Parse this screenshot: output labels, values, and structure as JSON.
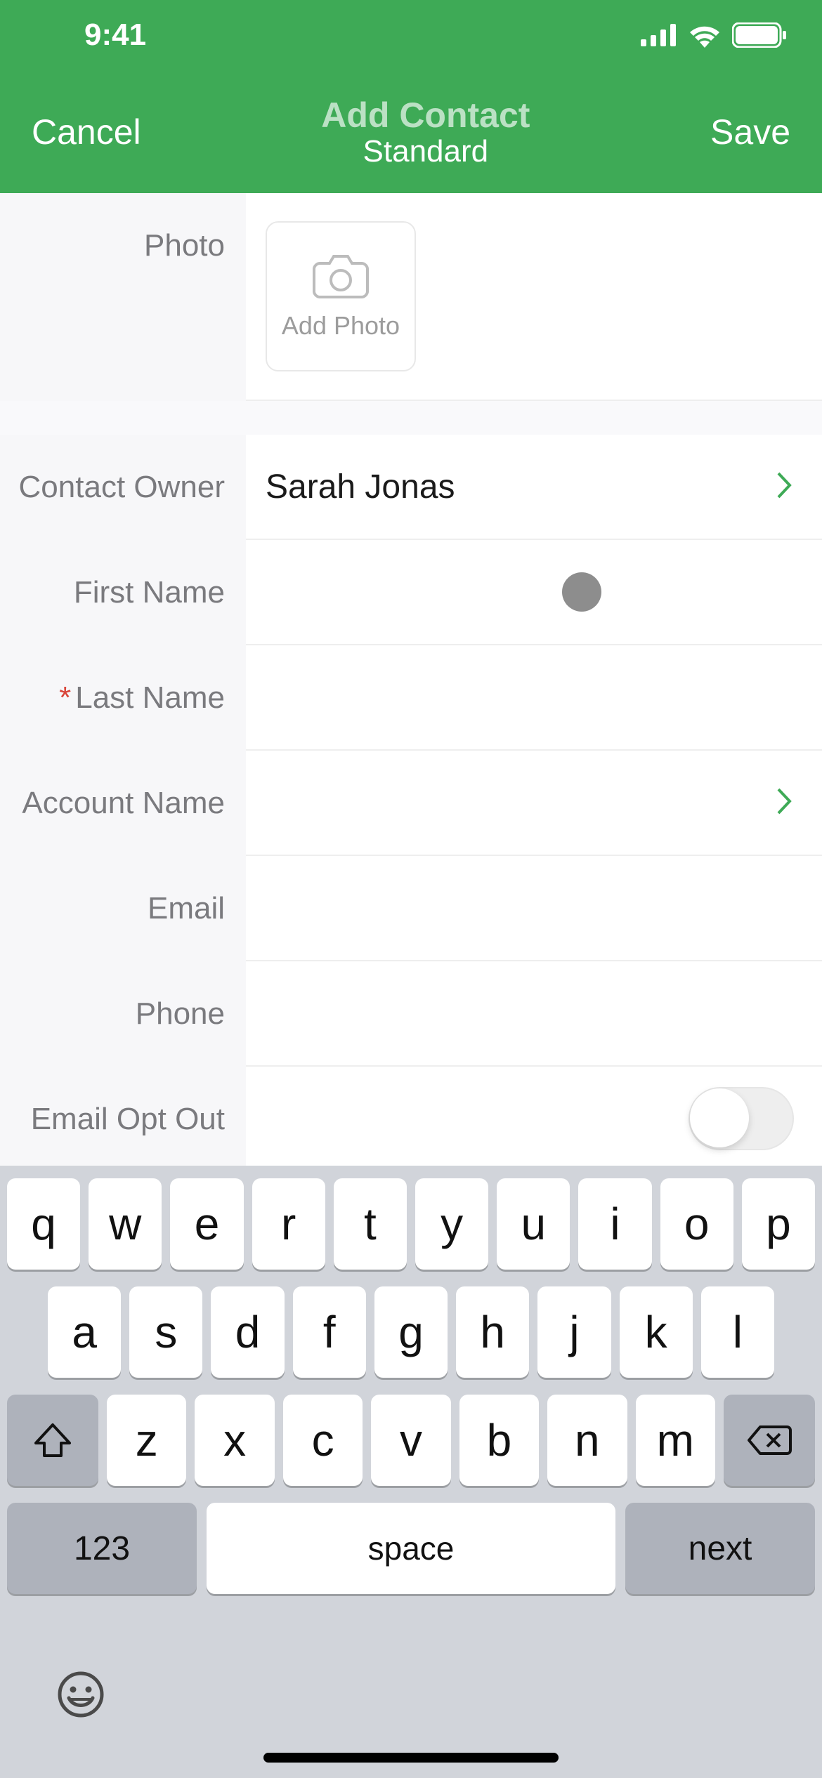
{
  "status": {
    "time": "9:41"
  },
  "nav": {
    "cancel": "Cancel",
    "title": "Add Contact",
    "subtitle": "Standard",
    "save": "Save"
  },
  "form": {
    "photo_label": "Photo",
    "add_photo": "Add Photo",
    "owner_label": "Contact Owner",
    "owner_value": "Sarah Jonas",
    "first_name_label": "First Name",
    "first_name_value": "",
    "last_name_label": "Last Name",
    "last_name_value": "",
    "account_label": "Account Name",
    "account_value": "",
    "email_label": "Email",
    "email_value": "",
    "phone_label": "Phone",
    "phone_value": "",
    "optout_label": "Email Opt Out",
    "optout_on": false
  },
  "keyboard": {
    "r1": [
      "q",
      "w",
      "e",
      "r",
      "t",
      "y",
      "u",
      "i",
      "o",
      "p"
    ],
    "r2": [
      "a",
      "s",
      "d",
      "f",
      "g",
      "h",
      "j",
      "k",
      "l"
    ],
    "r3": [
      "z",
      "x",
      "c",
      "v",
      "b",
      "n",
      "m"
    ],
    "k123": "123",
    "space": "space",
    "next": "next"
  }
}
